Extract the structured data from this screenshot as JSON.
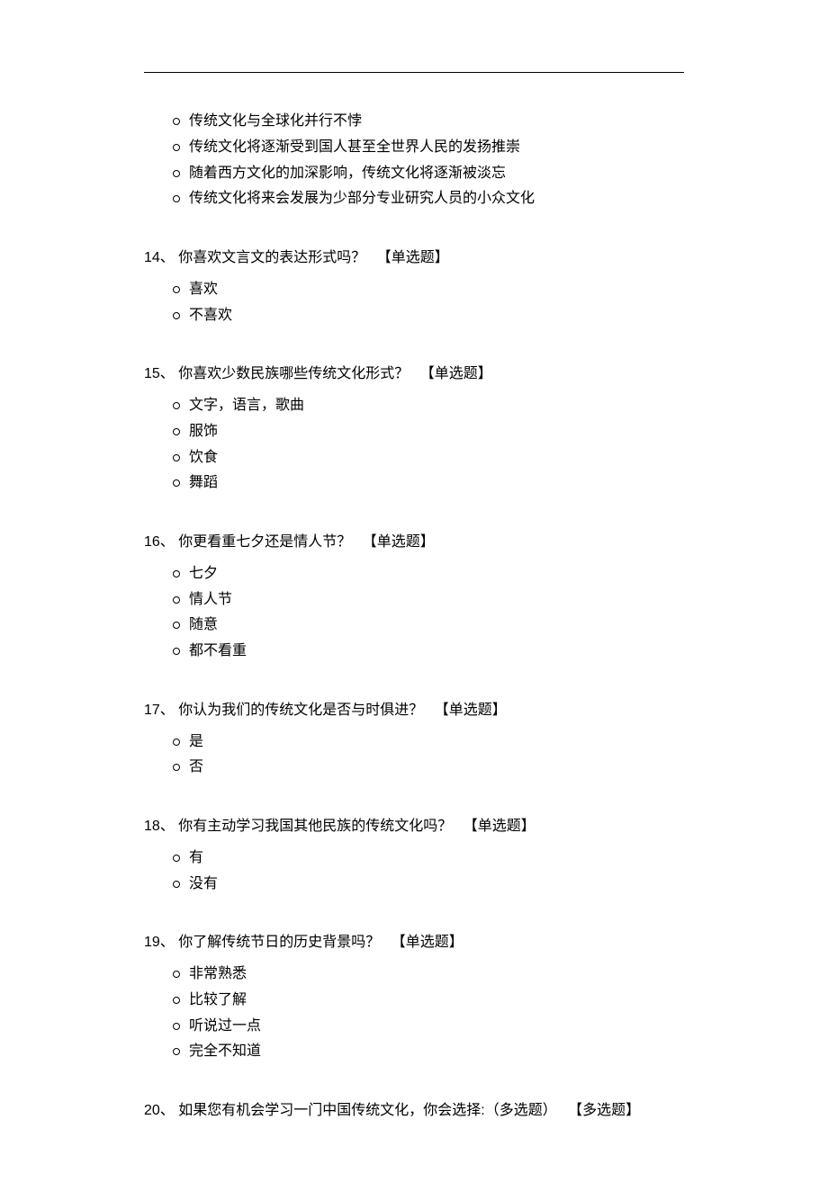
{
  "questions": [
    {
      "number": "",
      "text": "",
      "type": "",
      "options": [
        "传统文化与全球化并行不悖",
        "传统文化将逐渐受到国人甚至全世界人民的发扬推崇",
        "随着西方文化的加深影响，传统文化将逐渐被淡忘",
        "传统文化将来会发展为少部分专业研究人员的小众文化"
      ]
    },
    {
      "number": "14、",
      "text": "你喜欢文言文的表达形式吗？",
      "type": "【单选题】",
      "options": [
        "喜欢",
        "不喜欢"
      ]
    },
    {
      "number": "15、",
      "text": "你喜欢少数民族哪些传统文化形式？",
      "type": "【单选题】",
      "options": [
        "文字，语言，歌曲",
        "服饰",
        "饮食",
        "舞蹈"
      ]
    },
    {
      "number": "16、",
      "text": "你更看重七夕还是情人节？",
      "type": "【单选题】",
      "options": [
        "七夕",
        "情人节",
        "随意",
        "都不看重"
      ]
    },
    {
      "number": "17、",
      "text": "你认为我们的传统文化是否与时俱进？",
      "type": "【单选题】",
      "options": [
        "是",
        "否"
      ]
    },
    {
      "number": "18、",
      "text": "你有主动学习我国其他民族的传统文化吗？",
      "type": "【单选题】",
      "options": [
        "有",
        "没有"
      ]
    },
    {
      "number": "19、",
      "text": "你了解传统节日的历史背景吗？",
      "type": "【单选题】",
      "options": [
        "非常熟悉",
        "比较了解",
        "听说过一点",
        "完全不知道"
      ]
    },
    {
      "number": "20、",
      "text": "如果您有机会学习一门中国传统文化，你会选择:（多选题）",
      "type": "【多选题】",
      "options": []
    }
  ]
}
